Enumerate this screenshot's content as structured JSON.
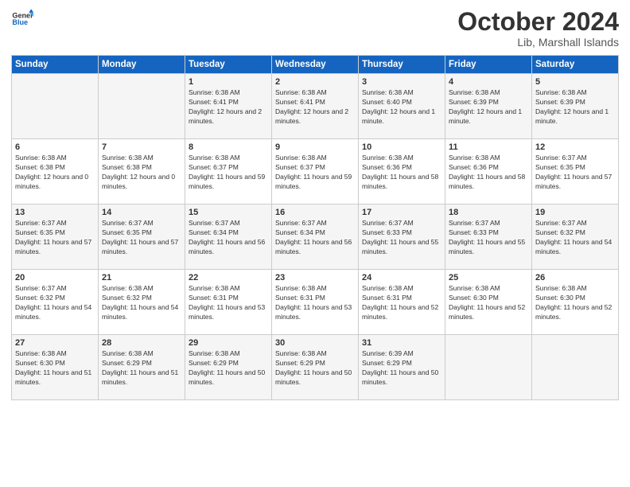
{
  "logo": {
    "line1": "General",
    "line2": "Blue"
  },
  "title": "October 2024",
  "location": "Lib, Marshall Islands",
  "days_of_week": [
    "Sunday",
    "Monday",
    "Tuesday",
    "Wednesday",
    "Thursday",
    "Friday",
    "Saturday"
  ],
  "weeks": [
    [
      {
        "day": "",
        "info": ""
      },
      {
        "day": "",
        "info": ""
      },
      {
        "day": "1",
        "info": "Sunrise: 6:38 AM\nSunset: 6:41 PM\nDaylight: 12 hours and 2 minutes."
      },
      {
        "day": "2",
        "info": "Sunrise: 6:38 AM\nSunset: 6:41 PM\nDaylight: 12 hours and 2 minutes."
      },
      {
        "day": "3",
        "info": "Sunrise: 6:38 AM\nSunset: 6:40 PM\nDaylight: 12 hours and 1 minute."
      },
      {
        "day": "4",
        "info": "Sunrise: 6:38 AM\nSunset: 6:39 PM\nDaylight: 12 hours and 1 minute."
      },
      {
        "day": "5",
        "info": "Sunrise: 6:38 AM\nSunset: 6:39 PM\nDaylight: 12 hours and 1 minute."
      }
    ],
    [
      {
        "day": "6",
        "info": "Sunrise: 6:38 AM\nSunset: 6:38 PM\nDaylight: 12 hours and 0 minutes."
      },
      {
        "day": "7",
        "info": "Sunrise: 6:38 AM\nSunset: 6:38 PM\nDaylight: 12 hours and 0 minutes."
      },
      {
        "day": "8",
        "info": "Sunrise: 6:38 AM\nSunset: 6:37 PM\nDaylight: 11 hours and 59 minutes."
      },
      {
        "day": "9",
        "info": "Sunrise: 6:38 AM\nSunset: 6:37 PM\nDaylight: 11 hours and 59 minutes."
      },
      {
        "day": "10",
        "info": "Sunrise: 6:38 AM\nSunset: 6:36 PM\nDaylight: 11 hours and 58 minutes."
      },
      {
        "day": "11",
        "info": "Sunrise: 6:38 AM\nSunset: 6:36 PM\nDaylight: 11 hours and 58 minutes."
      },
      {
        "day": "12",
        "info": "Sunrise: 6:37 AM\nSunset: 6:35 PM\nDaylight: 11 hours and 57 minutes."
      }
    ],
    [
      {
        "day": "13",
        "info": "Sunrise: 6:37 AM\nSunset: 6:35 PM\nDaylight: 11 hours and 57 minutes."
      },
      {
        "day": "14",
        "info": "Sunrise: 6:37 AM\nSunset: 6:35 PM\nDaylight: 11 hours and 57 minutes."
      },
      {
        "day": "15",
        "info": "Sunrise: 6:37 AM\nSunset: 6:34 PM\nDaylight: 11 hours and 56 minutes."
      },
      {
        "day": "16",
        "info": "Sunrise: 6:37 AM\nSunset: 6:34 PM\nDaylight: 11 hours and 56 minutes."
      },
      {
        "day": "17",
        "info": "Sunrise: 6:37 AM\nSunset: 6:33 PM\nDaylight: 11 hours and 55 minutes."
      },
      {
        "day": "18",
        "info": "Sunrise: 6:37 AM\nSunset: 6:33 PM\nDaylight: 11 hours and 55 minutes."
      },
      {
        "day": "19",
        "info": "Sunrise: 6:37 AM\nSunset: 6:32 PM\nDaylight: 11 hours and 54 minutes."
      }
    ],
    [
      {
        "day": "20",
        "info": "Sunrise: 6:37 AM\nSunset: 6:32 PM\nDaylight: 11 hours and 54 minutes."
      },
      {
        "day": "21",
        "info": "Sunrise: 6:38 AM\nSunset: 6:32 PM\nDaylight: 11 hours and 54 minutes."
      },
      {
        "day": "22",
        "info": "Sunrise: 6:38 AM\nSunset: 6:31 PM\nDaylight: 11 hours and 53 minutes."
      },
      {
        "day": "23",
        "info": "Sunrise: 6:38 AM\nSunset: 6:31 PM\nDaylight: 11 hours and 53 minutes."
      },
      {
        "day": "24",
        "info": "Sunrise: 6:38 AM\nSunset: 6:31 PM\nDaylight: 11 hours and 52 minutes."
      },
      {
        "day": "25",
        "info": "Sunrise: 6:38 AM\nSunset: 6:30 PM\nDaylight: 11 hours and 52 minutes."
      },
      {
        "day": "26",
        "info": "Sunrise: 6:38 AM\nSunset: 6:30 PM\nDaylight: 11 hours and 52 minutes."
      }
    ],
    [
      {
        "day": "27",
        "info": "Sunrise: 6:38 AM\nSunset: 6:30 PM\nDaylight: 11 hours and 51 minutes."
      },
      {
        "day": "28",
        "info": "Sunrise: 6:38 AM\nSunset: 6:29 PM\nDaylight: 11 hours and 51 minutes."
      },
      {
        "day": "29",
        "info": "Sunrise: 6:38 AM\nSunset: 6:29 PM\nDaylight: 11 hours and 50 minutes."
      },
      {
        "day": "30",
        "info": "Sunrise: 6:38 AM\nSunset: 6:29 PM\nDaylight: 11 hours and 50 minutes."
      },
      {
        "day": "31",
        "info": "Sunrise: 6:39 AM\nSunset: 6:29 PM\nDaylight: 11 hours and 50 minutes."
      },
      {
        "day": "",
        "info": ""
      },
      {
        "day": "",
        "info": ""
      }
    ]
  ]
}
